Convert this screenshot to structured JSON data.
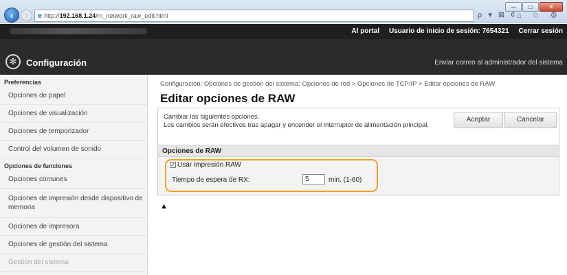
{
  "browser": {
    "url_prefix": "http://",
    "url_host": "192.168.1.24",
    "url_path": "/m_network_raw_edit.html",
    "addr_tools": "ρ ▾ ⊠ ¢",
    "tab_tools": "⌂ ☆ ⚙",
    "win_min": "─",
    "win_max": "□",
    "win_close": "✕"
  },
  "topbar": {
    "portal": "Al portal",
    "login_label": "Usuario de inicio de sesión:",
    "login_id": "7654321",
    "logout": "Cerrar sesión"
  },
  "header": {
    "title": "Configuración",
    "mail_admin": "Enviar correo al administrador del sistema"
  },
  "sidebar": {
    "sections": [
      {
        "title": "Preferencias"
      },
      {
        "title": "Opciones de funciones"
      }
    ],
    "items_pref": [
      {
        "label": "Opciones de papel"
      },
      {
        "label": "Opciones de visualización"
      },
      {
        "label": "Opciones de temporizador"
      },
      {
        "label": "Control del volumen de sonido"
      }
    ],
    "items_func": [
      {
        "label": "Opciones comunes"
      },
      {
        "label": "Opciones de impresión desde dispositivo de memoria"
      },
      {
        "label": "Opciones de impresora"
      }
    ],
    "mgmt_title": "Opciones de gestión del sistema",
    "mgmt_item": "Gestión del sistema"
  },
  "main": {
    "breadcrumb": "Configuración: Opciones de gestión del sistema: Opciones de red > Opciones de TCP/IP > Editar opciones de RAW",
    "title": "Editar opciones de RAW",
    "desc_line1": "Cambiar las siguientes opciones.",
    "desc_line2": "Los cambios serán efectivos tras apagar y encender el interruptor de alimentación principal.",
    "ok": "Aceptar",
    "cancel": "Cancelar",
    "section_title": "Opciones de RAW",
    "use_raw_label": "Usar impresión RAW",
    "use_raw_checked": true,
    "rx_label": "Tiempo de espera de RX:",
    "rx_value": "5",
    "rx_unit": "min. (1-60)",
    "top_link": "▲"
  },
  "colors": {
    "highlight": "#f0a020",
    "header_bg": "#2b2b2b",
    "topbar_bg": "#1f1f1f"
  }
}
